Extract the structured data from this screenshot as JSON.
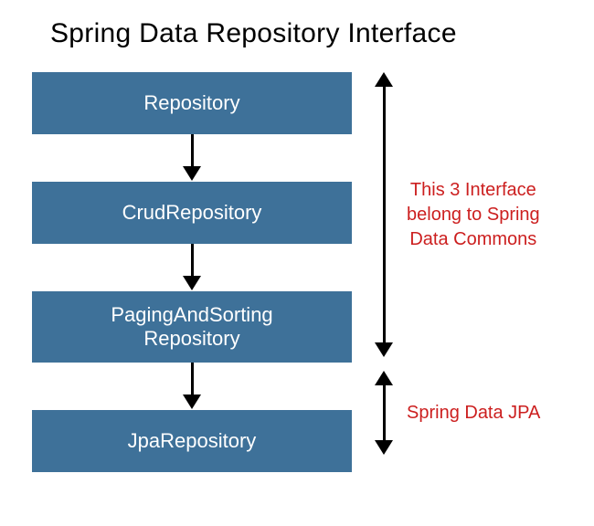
{
  "title": "Spring Data Repository Interface",
  "boxes": {
    "b1": "Repository",
    "b2": "CrudRepository",
    "b3_line1": "PagingAndSorting",
    "b3_line2": "Repository",
    "b4": "JpaRepository"
  },
  "annotations": {
    "group1_l1": "This 3 Interface",
    "group1_l2": "belong to Spring",
    "group1_l3": "Data Commons",
    "group2": "Spring Data JPA"
  },
  "colors": {
    "box_bg": "#3e7199",
    "annotation": "#cc1f1f"
  }
}
